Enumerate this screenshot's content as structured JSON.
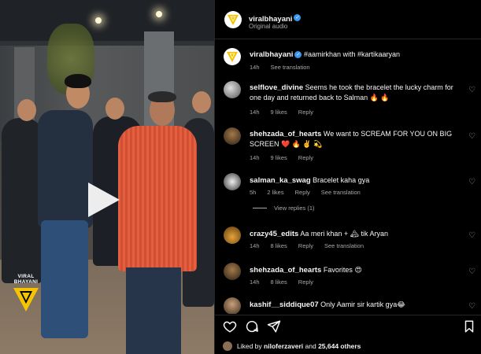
{
  "media": {
    "watermark": "VIRAL BHAYANI"
  },
  "post_header": {
    "username": "viralbhayani",
    "subtitle": "Original audio"
  },
  "caption": {
    "username": "viralbhayani",
    "text": "#aamirkhan with #kartikaaryan",
    "time": "14h",
    "see_translation": "See translation"
  },
  "comments": [
    {
      "username": "selflove_divine",
      "text": "Seems he took the bracelet the lucky charm for one day and returned back to Salman 🔥 🔥",
      "time": "14h",
      "likes": "9 likes",
      "reply": "Reply"
    },
    {
      "username": "shehzada_of_hearts",
      "text": "We want to SCREAM FOR YOU ON BIG SCREEN ❤️ 🔥 ✌️ 💫",
      "time": "14h",
      "likes": "9 likes",
      "reply": "Reply"
    },
    {
      "username": "salman_ka_swag",
      "text": "Bracelet kaha gya",
      "time": "5h",
      "likes": "2 likes",
      "reply": "Reply",
      "see_translation": "See translation",
      "view_replies": "View replies (1)"
    },
    {
      "username": "crazy45_edits",
      "text": "Aa meri khan + 🏔 tik Aryan",
      "time": "14h",
      "likes": "8 likes",
      "reply": "Reply",
      "see_translation": "See translation"
    },
    {
      "username": "shehzada_of_hearts",
      "text": "Favorites 😍",
      "time": "14h",
      "likes": "8 likes",
      "reply": "Reply"
    },
    {
      "username": "kashif__siddique07",
      "text": "Only Aamir sir kartik gya😂"
    }
  ],
  "likes": {
    "prefix": "Liked by",
    "user": "niloferzaveri",
    "and": "and",
    "count": "25,644 others"
  },
  "colors": {
    "background": "#000000",
    "text": "#f5f5f5",
    "muted": "#a8a8a8",
    "verified": "#3897f0",
    "logo_yellow": "#f5c400"
  }
}
